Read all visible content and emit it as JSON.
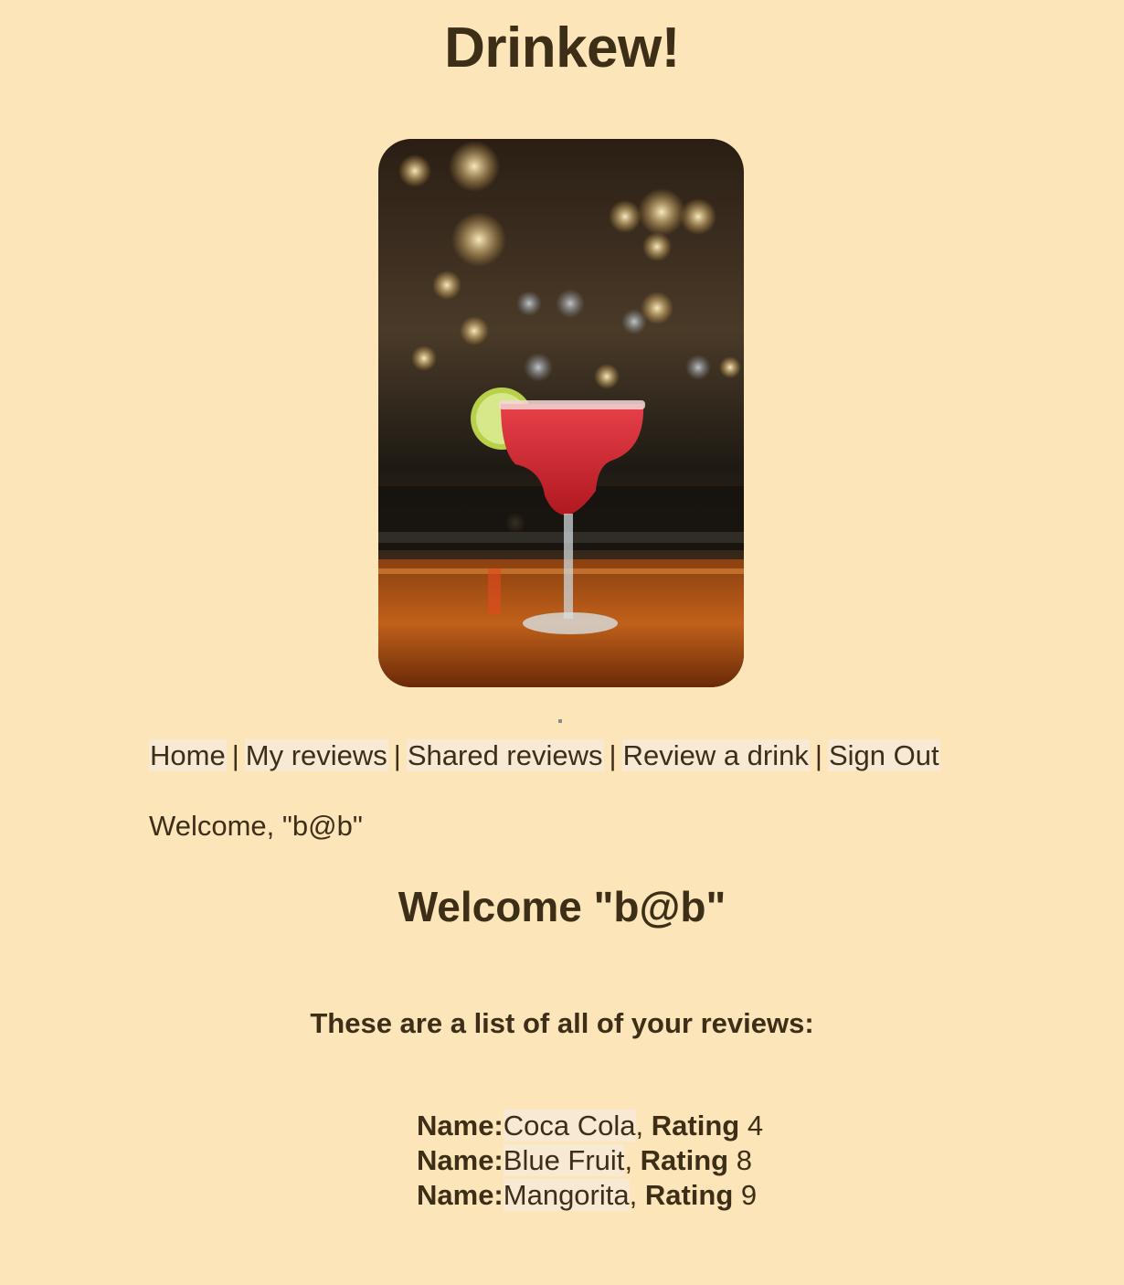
{
  "site": {
    "title": "Drinkew!"
  },
  "hero": {
    "image_alt": "cocktail-photo"
  },
  "nav": {
    "items": [
      {
        "label": "Home"
      },
      {
        "label": "My reviews"
      },
      {
        "label": "Shared reviews"
      },
      {
        "label": "Review a drink"
      },
      {
        "label": "Sign Out"
      }
    ],
    "separator": "|"
  },
  "user": {
    "welcome_line": "Welcome, \"b@b\"",
    "welcome_heading": "Welcome \"b@b\""
  },
  "reviews": {
    "intro": "These are a list of all of your reviews:",
    "name_label": "Name:",
    "rating_label": "Rating",
    "items": [
      {
        "name": "Coca Cola",
        "rating": "4"
      },
      {
        "name": "Blue Fruit",
        "rating": "8"
      },
      {
        "name": "Mangorita",
        "rating": "9"
      }
    ]
  },
  "colors": {
    "background": "#fce5b8",
    "text": "#3d2e18",
    "link_highlight": "#f7e9d3"
  }
}
